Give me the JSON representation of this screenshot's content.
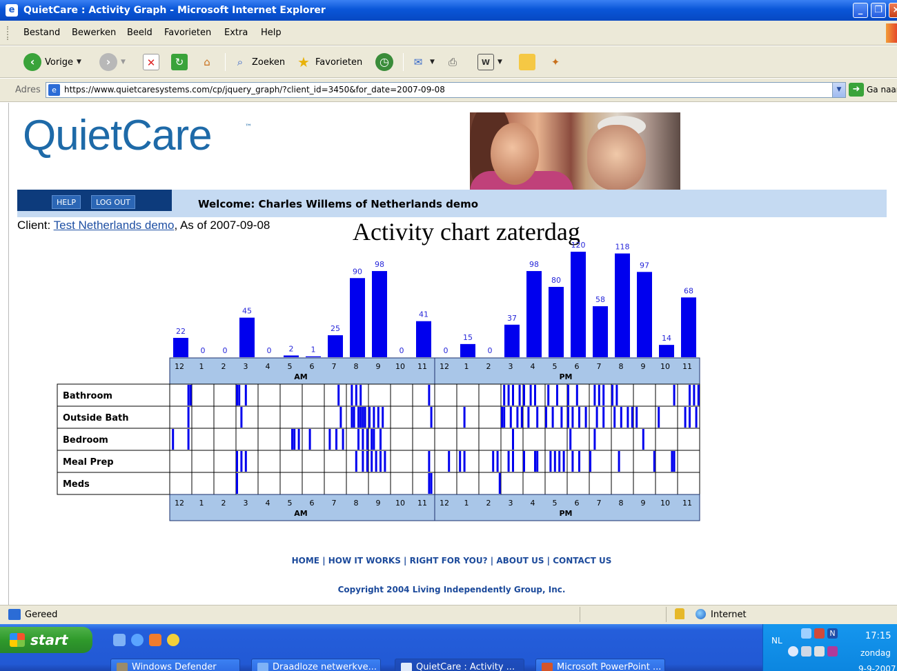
{
  "window": {
    "title": "QuietCare : Activity Graph - Microsoft Internet Explorer"
  },
  "menu": [
    "Bestand",
    "Bewerken",
    "Beeld",
    "Favorieten",
    "Extra",
    "Help"
  ],
  "toolbar": {
    "back_label": "Vorige",
    "search_label": "Zoeken",
    "favorites_label": "Favorieten"
  },
  "address": {
    "label": "Adres",
    "url": "https://www.quietcaresystems.com/cp/jquery_graph/?client_id=3450&for_date=2007-09-08",
    "go_label": "Ga naar"
  },
  "page": {
    "logo": "QuietCare",
    "logo_tm": "™",
    "help_label": "HELP",
    "logout_label": "LOG OUT",
    "welcome": "Welcome: Charles Willems of Netherlands demo",
    "client_prefix": "Client: ",
    "client_link": "Test Netherlands demo",
    "as_of": ", As of 2007-09-08",
    "chart_title": "Activity chart zaterdag",
    "footer_links": [
      "HOME",
      "HOW IT WORKS",
      "RIGHT FOR YOU?",
      "ABOUT US",
      "CONTACT US"
    ],
    "copyright": "Copyright 2004 Living Independently Group, Inc."
  },
  "chart_data": {
    "type": "bar",
    "hour_labels": [
      "12",
      "1",
      "2",
      "3",
      "4",
      "5",
      "6",
      "7",
      "8",
      "9",
      "10",
      "11",
      "12",
      "1",
      "2",
      "3",
      "4",
      "5",
      "6",
      "7",
      "8",
      "9",
      "10",
      "11"
    ],
    "period_labels": [
      "AM",
      "PM"
    ],
    "values": [
      22,
      0,
      0,
      45,
      0,
      2,
      1,
      25,
      90,
      98,
      0,
      41,
      0,
      15,
      0,
      37,
      98,
      80,
      120,
      58,
      118,
      97,
      14,
      68
    ],
    "ylim": [
      0,
      120
    ],
    "bar_color": "#0000ee",
    "label_color": "#2626d9",
    "axis_band_color": "#a9c6e8",
    "rooms": [
      {
        "label": "Bathroom",
        "events": [
          0.8,
          0.9,
          3.0,
          3.1,
          3.4,
          7.6,
          8.2,
          8.4,
          8.6,
          11.7,
          15.1,
          15.3,
          15.5,
          15.8,
          16.0,
          16.3,
          16.5,
          17.1,
          17.5,
          18.0,
          18.4,
          19.2,
          19.4,
          19.6,
          20.0,
          20.2,
          22.8,
          23.5,
          23.7,
          23.9
        ]
      },
      {
        "label": "Outside Bath",
        "events": [
          0.8,
          3.2,
          13.3,
          15.0,
          15.1,
          15.4,
          15.7,
          15.9,
          16.2,
          16.6,
          17.0,
          17.3,
          17.7,
          18.0,
          18.2,
          18.5,
          18.8,
          19.3,
          19.6,
          20.1,
          20.4,
          20.7,
          20.9,
          21.1,
          22.1,
          23.3,
          23.5,
          23.8,
          8.2,
          8.3,
          8.5,
          8.6,
          8.7,
          8.8,
          9.0,
          9.2,
          9.4,
          9.6,
          7.7,
          11.8
        ]
      },
      {
        "label": "Bedroom",
        "events": [
          0.1,
          0.8,
          5.5,
          5.6,
          5.8,
          6.3,
          7.2,
          7.5,
          7.8,
          8.5,
          8.7,
          8.9,
          9.1,
          9.2,
          9.5,
          15.5,
          18.1,
          19.2,
          21.4
        ]
      },
      {
        "label": "Meal Prep",
        "events": [
          3.0,
          3.2,
          3.4,
          8.4,
          8.7,
          8.9,
          9.1,
          9.3,
          9.5,
          9.7,
          11.7,
          12.6,
          13.1,
          13.3,
          14.6,
          14.8,
          15.3,
          15.5,
          16.0,
          16.5,
          16.6,
          17.2,
          17.4,
          17.6,
          17.8,
          18.2,
          18.5,
          19.0,
          20.3,
          21.9,
          22.7,
          22.8
        ]
      },
      {
        "label": "Meds",
        "events": [
          3.0,
          11.7,
          11.8,
          14.9
        ]
      }
    ]
  },
  "status": {
    "text": "Gereed",
    "zone": "Internet"
  },
  "taskbar": {
    "start_label": "start",
    "tasks": [
      "Windows Defender",
      "Draadloze netwerkve...",
      "QuietCare : Activity ...",
      "Microsoft PowerPoint ..."
    ],
    "lang": "NL",
    "time": "17:15",
    "day": "zondag",
    "date": "9-9-2007"
  }
}
